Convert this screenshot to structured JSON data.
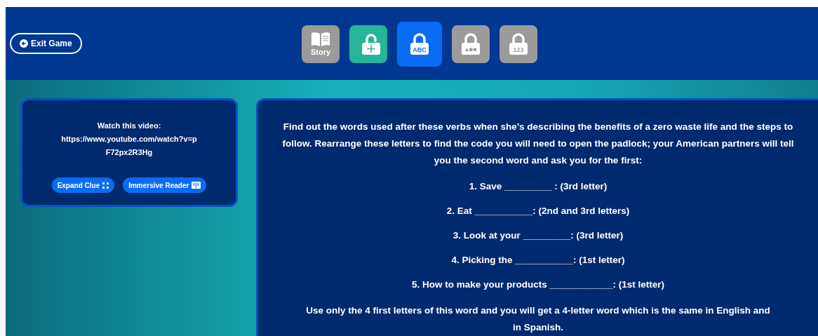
{
  "header": {
    "exit_button": "Exit Game",
    "locks": [
      {
        "kind": "story",
        "label": "Story",
        "selected": false
      },
      {
        "kind": "directional",
        "unlocked": true,
        "selected": false
      },
      {
        "kind": "text",
        "label": "ABC",
        "unlocked": false,
        "selected": true
      },
      {
        "kind": "shapes",
        "unlocked": false,
        "selected": false
      },
      {
        "kind": "text",
        "label": "123",
        "unlocked": false,
        "selected": false
      }
    ]
  },
  "clue_card": {
    "lines": [
      "Watch this video:",
      "https://www.youtube.com/watch?v=pF72px2R3Hg"
    ],
    "expand_button": "Expand Clue",
    "reader_button": "Immersive Reader"
  },
  "puzzle": {
    "intro": "Find out the words used after these verbs when she’s describing the benefits of a zero waste life and the steps to follow. Rearrange these letters to find the code you will need to open the padlock; your American partners will tell you the second word and ask you for the first:",
    "items": [
      "1. Save _________ : (3rd letter)",
      "2. Eat ___________: (2nd and 3rd letters)",
      "3. Look at your _________: (3rd letter)",
      "4. Picking the ___________: (1st letter)",
      "5. How to make your products ____________: (1st letter)"
    ],
    "outro": "Use only the 4 first letters of this word and you will get a 4-letter word which is the same in English and in Spanish."
  }
}
